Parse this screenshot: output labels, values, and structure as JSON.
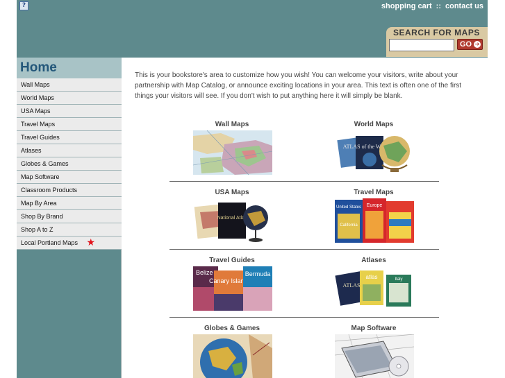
{
  "header": {
    "help_glyph": "?",
    "shopping_cart": "shopping cart",
    "separator": "::",
    "contact_us": "contact us"
  },
  "search": {
    "title": "SEARCH FOR MAPS",
    "value": "",
    "go_label": "GO",
    "go_arrow": "➔"
  },
  "sidebar": {
    "title": "Home",
    "items": [
      {
        "label": "Wall Maps"
      },
      {
        "label": "World Maps"
      },
      {
        "label": "USA Maps"
      },
      {
        "label": "Travel Maps"
      },
      {
        "label": "Travel Guides"
      },
      {
        "label": "Atlases"
      },
      {
        "label": "Globes & Games"
      },
      {
        "label": "Map Software"
      },
      {
        "label": "Classroom Products"
      },
      {
        "label": "Map By Area"
      },
      {
        "label": "Shop By Brand"
      },
      {
        "label": "Shop A to Z"
      },
      {
        "label": "Local Portland Maps",
        "icon": "star-icon",
        "glyph": "★"
      }
    ]
  },
  "main": {
    "intro": "This is your bookstore's area to customize how you wish! You can welcome your visitors, write about your partnership with Map Catalog, or announce exciting locations in your area. This text is often one of the first things your visitors will see. If you don't wish to put anything here it will simply be blank.",
    "categories": [
      {
        "label": "Wall Maps"
      },
      {
        "label": "World Maps"
      },
      {
        "label": "USA Maps"
      },
      {
        "label": "Travel Maps"
      },
      {
        "label": "Travel Guides"
      },
      {
        "label": "Atlases"
      },
      {
        "label": "Globes & Games"
      },
      {
        "label": "Map Software"
      }
    ],
    "image_text": {
      "atlas_world": "ATLAS of the WORLD",
      "national_atlas": "National Atlas",
      "united_states": "United States",
      "california": "California",
      "europe": "Europe",
      "belize": "Belize",
      "canary_islands": "Canary Islands",
      "bermuda": "Bermuda",
      "atlas": "ATLAS",
      "atlas_lower": "atlas",
      "italy": "Italy"
    }
  },
  "colors": {
    "header_teal": "#5e8a8d",
    "sidebar_title_bg": "#a8c3c6",
    "search_tan": "#d9c9a3",
    "go_red": "#b03a2e",
    "star_red": "#e2141c"
  }
}
